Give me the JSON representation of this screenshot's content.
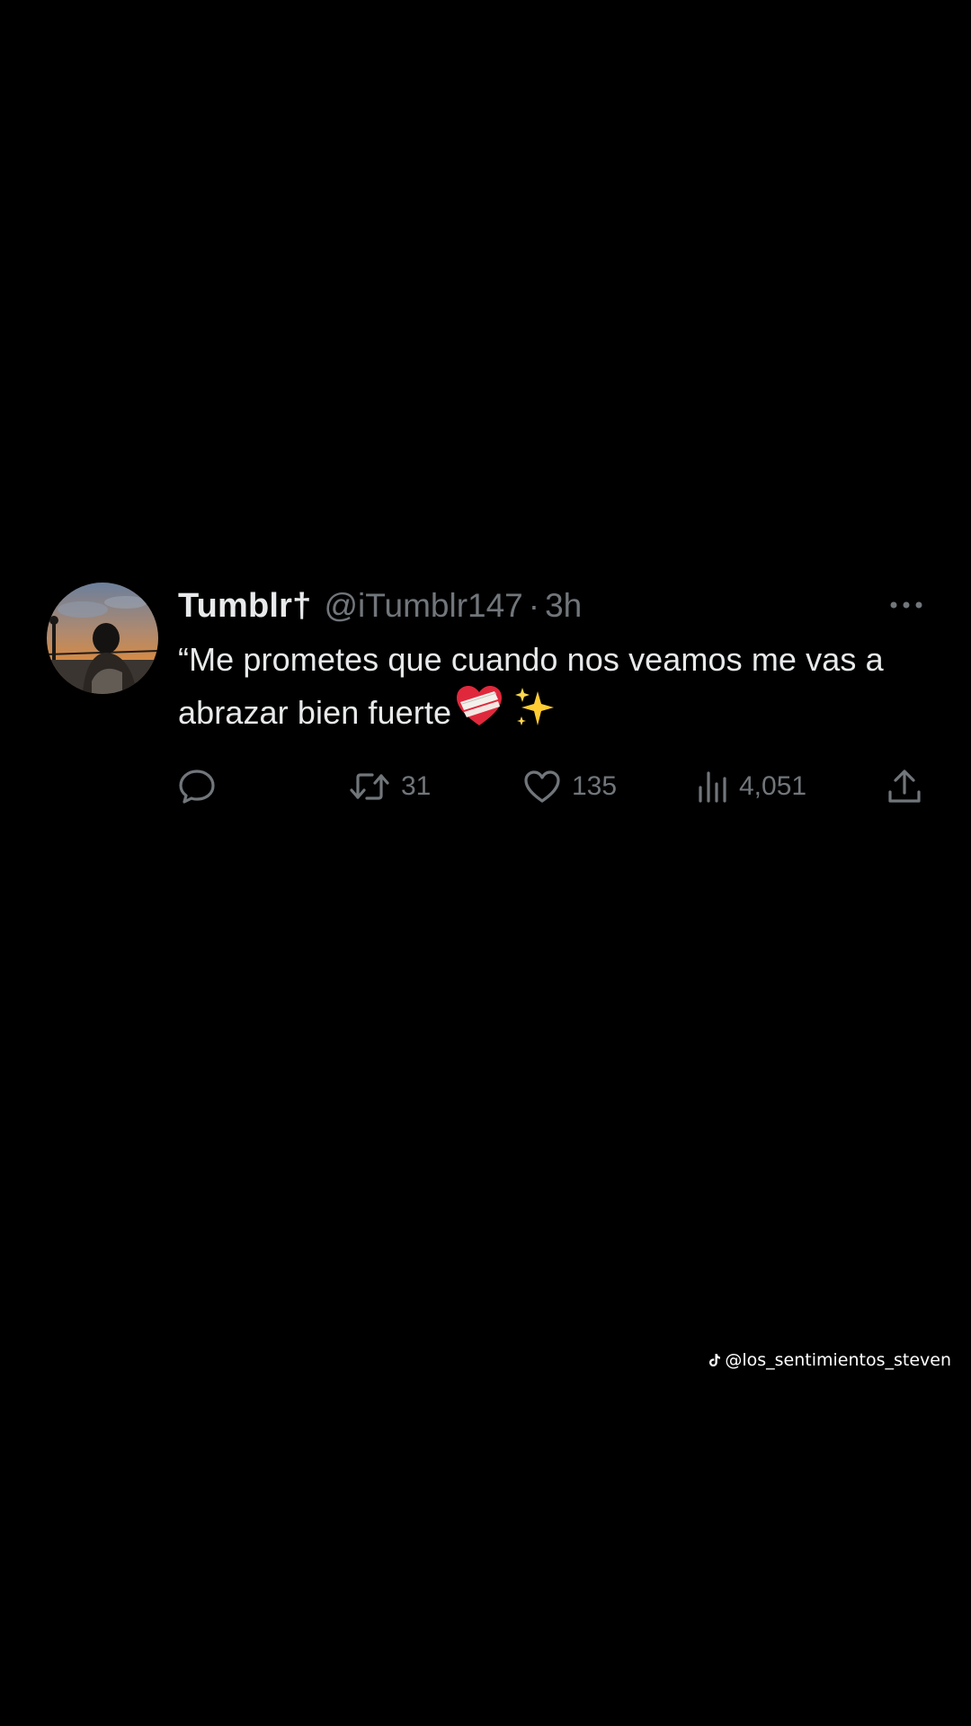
{
  "tweet": {
    "display_name": "Tumblr†",
    "handle": "@iTumblr147",
    "separator": "·",
    "time": "3h",
    "text": "“Me prometes que cuando nos veamos me vas a abrazar bien fuerte",
    "emojis": "❤️‍🩹 ✨",
    "stats": {
      "retweets": "31",
      "likes": "135",
      "views": "4,051"
    }
  },
  "watermark": {
    "handle": "@los_sentimientos_steven"
  },
  "colors": {
    "background": "#000000",
    "primary_text": "#e7e9ea",
    "secondary_text": "#71767b"
  },
  "icons": [
    "avatar",
    "more-icon",
    "reply-icon",
    "retweet-icon",
    "like-icon",
    "views-icon",
    "share-icon",
    "tiktok-icon",
    "mending-heart-icon",
    "sparkles-icon"
  ]
}
